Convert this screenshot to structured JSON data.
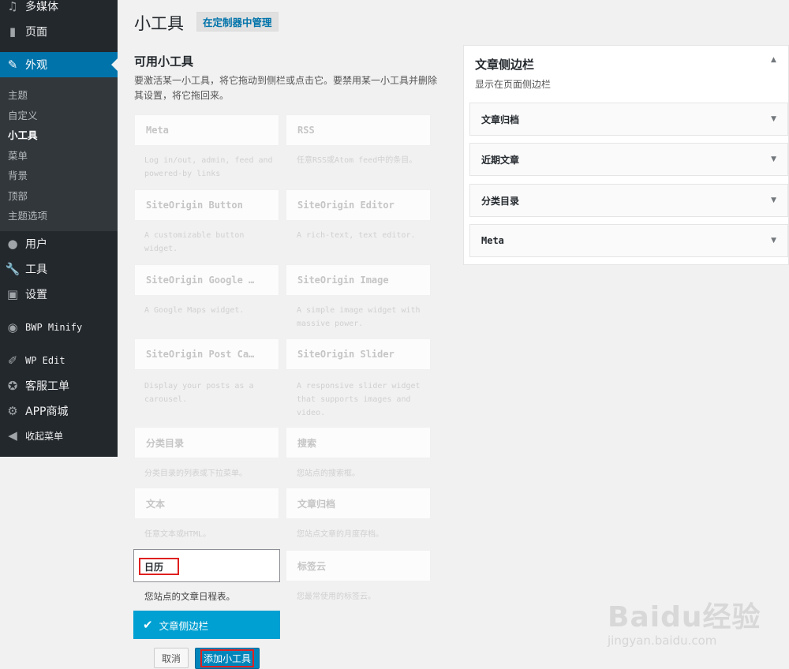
{
  "sidebar": {
    "menu": [
      {
        "label": "多媒体",
        "icon": "media-icon"
      },
      {
        "label": "页面",
        "icon": "page-icon"
      },
      {
        "label": "外观",
        "icon": "appearance-icon"
      },
      {
        "label": "用户",
        "icon": "users-icon"
      },
      {
        "label": "工具",
        "icon": "tools-icon"
      },
      {
        "label": "设置",
        "icon": "settings-icon"
      },
      {
        "label": "BWP Minify",
        "icon": "dashboard-icon"
      },
      {
        "label": "WP Edit",
        "icon": "edit-icon"
      },
      {
        "label": "客服工单",
        "icon": "lifebuoy-icon"
      },
      {
        "label": "APP商城",
        "icon": "gear-icon"
      },
      {
        "label": "收起菜单",
        "icon": "collapse-icon"
      }
    ],
    "submenu": [
      "主题",
      "自定义",
      "小工具",
      "菜单",
      "背景",
      "顶部",
      "主题选项"
    ]
  },
  "header": {
    "title": "小工具",
    "manage_label": "在定制器中管理"
  },
  "available": {
    "title": "可用小工具",
    "description": "要激活某一小工具，将它拖动到侧栏或点击它。要禁用某一小工具并删除其设置，将它拖回来。"
  },
  "widgets": [
    {
      "title": "Meta",
      "desc": "Log in/out, admin, feed and powered-by links"
    },
    {
      "title": "RSS",
      "desc": "任意RSS或Atom feed中的条目。"
    },
    {
      "title": "SiteOrigin Button",
      "desc": "A customizable button widget."
    },
    {
      "title": "SiteOrigin Editor",
      "desc": "A rich-text, text editor."
    },
    {
      "title": "SiteOrigin Google …",
      "desc": "A Google Maps widget."
    },
    {
      "title": "SiteOrigin Image",
      "desc": "A simple image widget with massive power."
    },
    {
      "title": "SiteOrigin Post Ca…",
      "desc": "Display your posts as a carousel."
    },
    {
      "title": "SiteOrigin Slider",
      "desc": "A responsive slider widget that supports images and video."
    },
    {
      "title": "分类目录",
      "desc": "分类目录的列表或下拉菜单。"
    },
    {
      "title": "搜索",
      "desc": "您站点的搜索框。"
    },
    {
      "title": "文本",
      "desc": "任意文本或HTML。"
    },
    {
      "title": "文章归档",
      "desc": "您站点文章的月度存档。"
    },
    {
      "title": "标签云",
      "desc": "您最常使用的标签云。"
    }
  ],
  "calendar": {
    "title": "日历",
    "desc": "您站点的文章日程表。",
    "sidebar_choice": "文章侧边栏",
    "cancel_label": "取消",
    "add_label": "添加小工具"
  },
  "sidebar_panel": {
    "title": "文章侧边栏",
    "subtitle": "显示在页面侧边栏",
    "widgets": [
      "文章归档",
      "近期文章",
      "分类目录",
      "Meta"
    ]
  },
  "watermark": {
    "brand": "Baidu经验",
    "url": "jingyan.baidu.com"
  }
}
